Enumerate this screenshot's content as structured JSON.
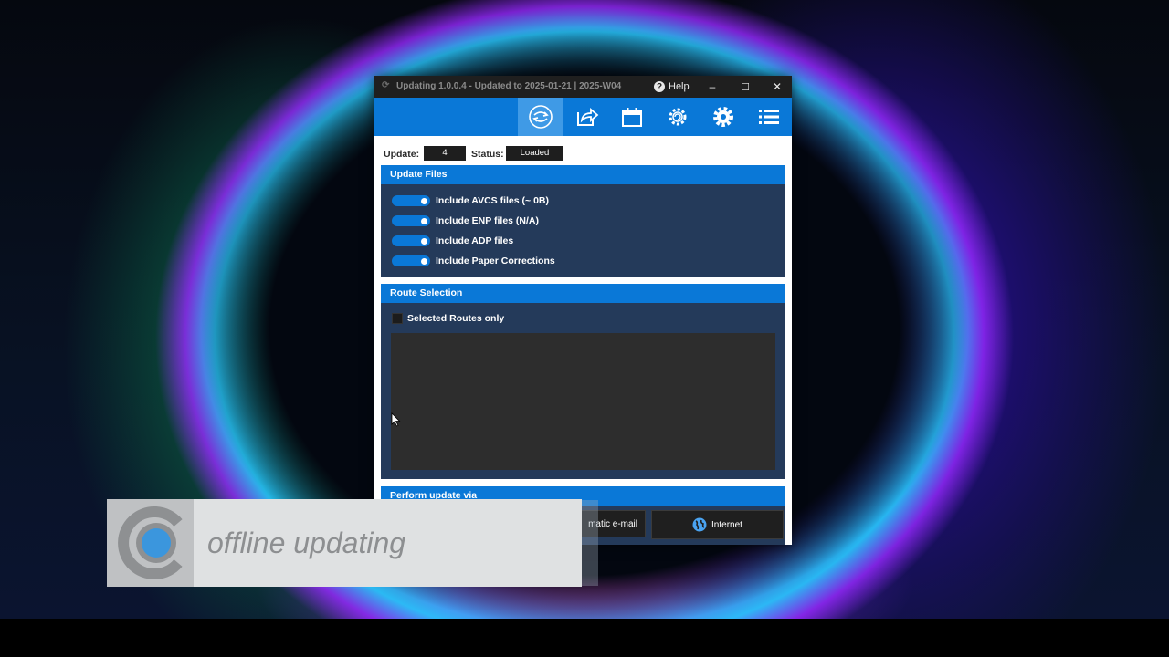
{
  "window": {
    "title": "Updating 1.0.0.4 - Updated to 2025-01-21 | 2025-W04",
    "help_label": "Help",
    "minimize_glyph": "–",
    "maximize_glyph": "☐",
    "close_glyph": "✕"
  },
  "toolbar": {
    "items": [
      {
        "icon": "sync-icon",
        "active": true
      },
      {
        "icon": "share-icon",
        "active": false
      },
      {
        "icon": "calendar-icon",
        "active": false
      },
      {
        "icon": "gear-refresh-icon",
        "active": false
      },
      {
        "icon": "gear-icon",
        "active": false
      },
      {
        "icon": "menu-list-icon",
        "active": false
      }
    ]
  },
  "status_row": {
    "update_label": "Update:",
    "update_value": "4",
    "status_label": "Status:",
    "status_value": "Loaded"
  },
  "update_files": {
    "title": "Update Files",
    "options": [
      {
        "label": "Include AVCS files (~ 0B)",
        "on": true
      },
      {
        "label": "Include ENP files (N/A)",
        "on": true
      },
      {
        "label": "Include ADP files",
        "on": true
      },
      {
        "label": "Include Paper Corrections",
        "on": true
      }
    ]
  },
  "route_selection": {
    "title": "Route Selection",
    "checkbox_label": "Selected Routes only",
    "checked": false
  },
  "perform": {
    "title": "Perform update via",
    "email_label": "matic e-mail",
    "internet_label": "Internet"
  },
  "caption": {
    "text": "offline updating"
  },
  "colors": {
    "accent": "#0a78d7",
    "panel": "#243a5a",
    "titlebar": "#1f1f1f"
  }
}
